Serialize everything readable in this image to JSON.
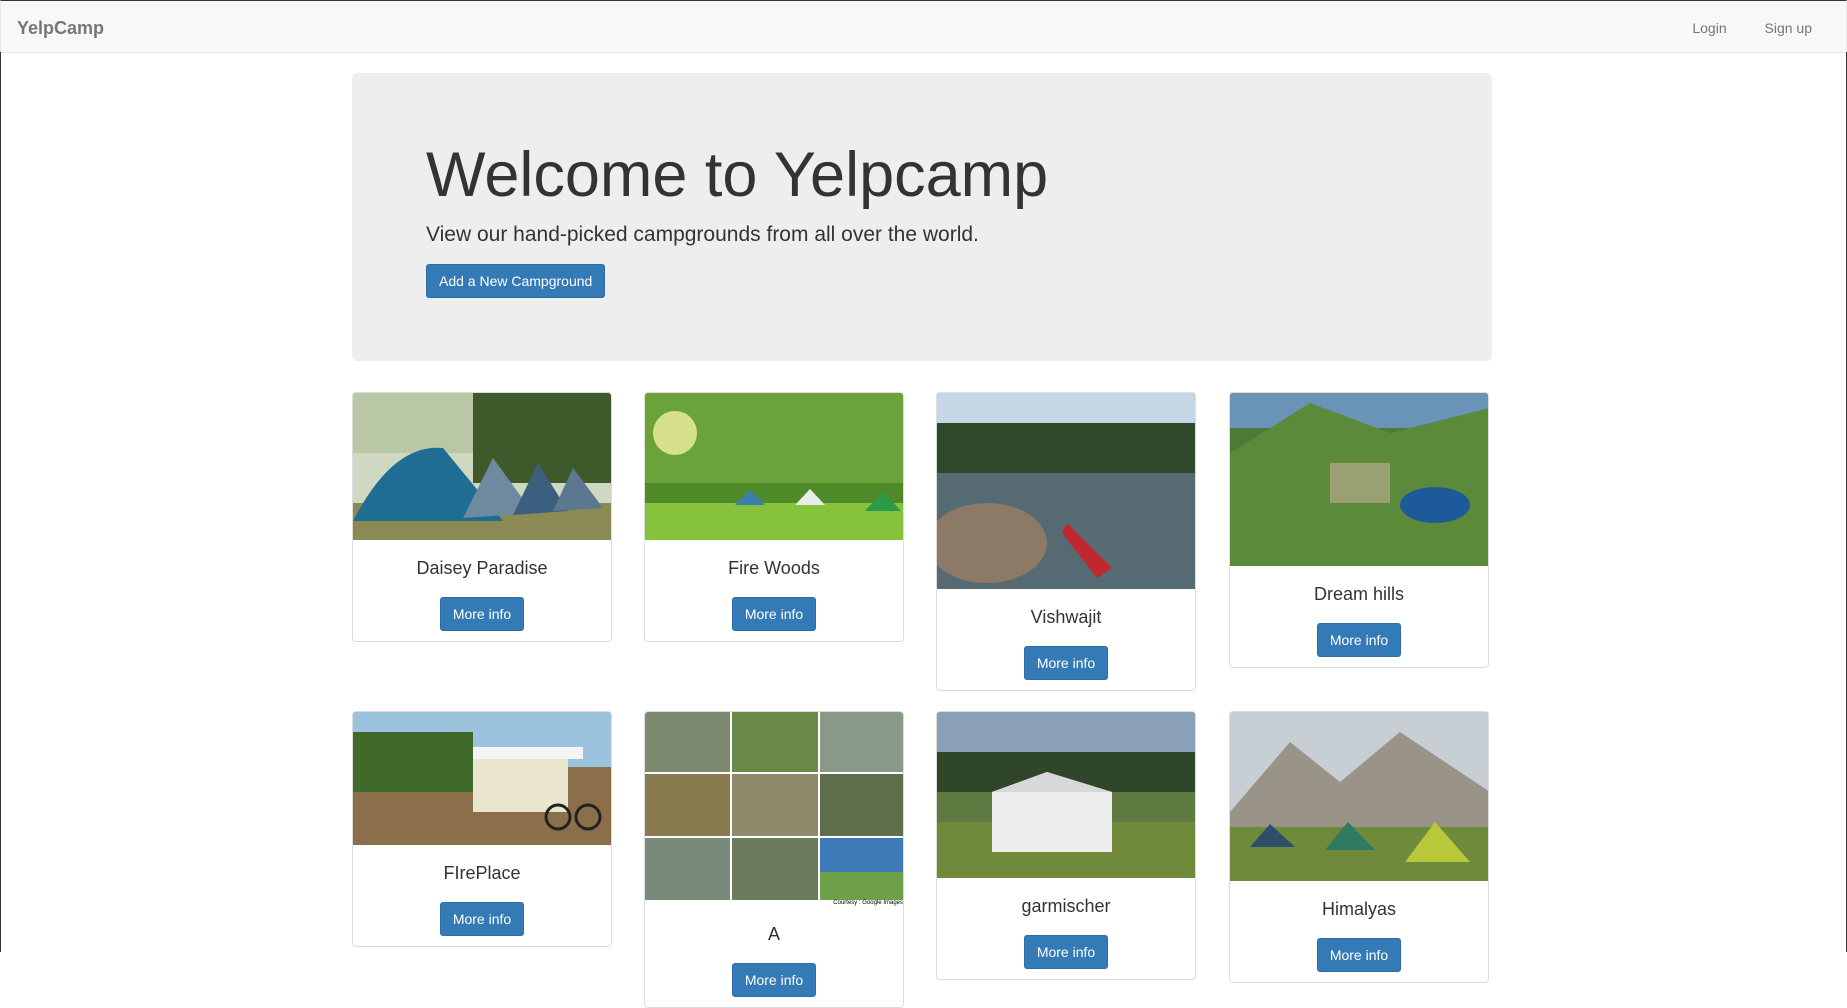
{
  "navbar": {
    "brand": "YelpCamp",
    "login": "Login",
    "signup": "Sign up"
  },
  "jumbotron": {
    "title": "Welcome to Yelpcamp",
    "subtitle": "View our hand-picked campgrounds from all over the world.",
    "add_button": "Add a New Campground"
  },
  "campgrounds": [
    {
      "name": "Daisey Paradise",
      "button": "More info"
    },
    {
      "name": "Fire Woods",
      "button": "More info"
    },
    {
      "name": "Vishwajit",
      "button": "More info"
    },
    {
      "name": "Dream hills",
      "button": "More info"
    },
    {
      "name": "FIrePlace",
      "button": "More info"
    },
    {
      "name": "A",
      "button": "More info",
      "image_caption": "Courtesy : Google Images"
    },
    {
      "name": "garmischer",
      "button": "More info"
    },
    {
      "name": "Himalyas",
      "button": "More info"
    }
  ],
  "colors": {
    "primary": "#337ab7",
    "jumbotron_bg": "#eeeeee",
    "navbar_bg": "#f8f8f8"
  }
}
